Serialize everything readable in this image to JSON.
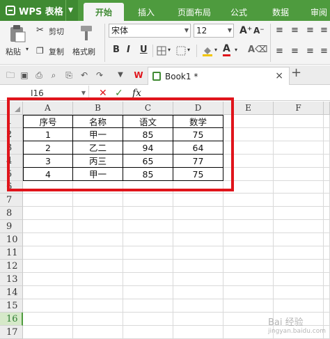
{
  "app": {
    "name": "WPS 表格"
  },
  "tabs": [
    "开始",
    "插入",
    "页面布局",
    "公式",
    "数据",
    "审阅"
  ],
  "ribbon": {
    "paste": "粘贴",
    "cut": "剪切",
    "copy": "复制",
    "format_painter": "格式刷",
    "font_name": "宋体",
    "font_size": "12",
    "bold": "B",
    "italic": "I",
    "underline": "U"
  },
  "document": {
    "tab_title": "Book1 *"
  },
  "formula_bar": {
    "cell_ref": "I16",
    "cancel": "✕",
    "confirm": "✓",
    "fx": "fx"
  },
  "columns": [
    "A",
    "B",
    "C",
    "D",
    "E",
    "F"
  ],
  "rows": [
    "1",
    "2",
    "3",
    "4",
    "5",
    "6",
    "7",
    "8",
    "9",
    "10",
    "11",
    "12",
    "13",
    "14",
    "15",
    "16",
    "17"
  ],
  "table": {
    "headers": [
      "序号",
      "名称",
      "语文",
      "数学"
    ],
    "rows": [
      [
        "1",
        "甲一",
        "85",
        "75"
      ],
      [
        "2",
        "乙二",
        "94",
        "64"
      ],
      [
        "3",
        "丙三",
        "65",
        "77"
      ],
      [
        "4",
        "甲一",
        "85",
        "75"
      ]
    ]
  },
  "selected_row": "16",
  "colors": {
    "accent": "#4e9b3e",
    "highlight": "#e0141b"
  },
  "watermark": {
    "text": "Bai 经验",
    "sub": "jingyan.baidu.com"
  }
}
